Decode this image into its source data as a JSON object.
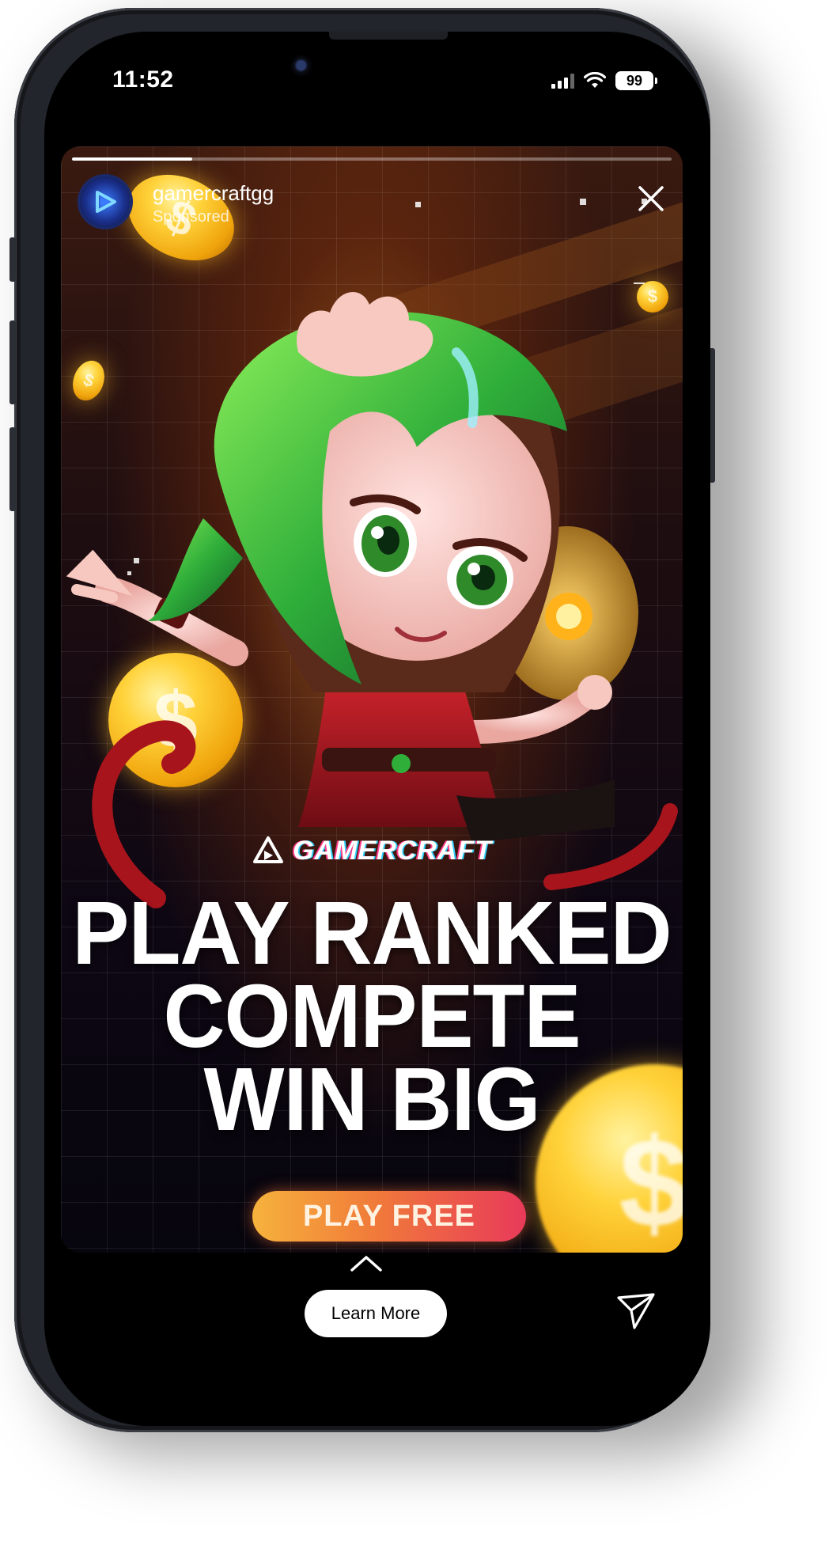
{
  "status_bar": {
    "time": "11:52",
    "battery": "99",
    "signal_icon": "cellular-signal-icon",
    "wifi_icon": "wifi-icon"
  },
  "story": {
    "progress_fraction": 0.2,
    "account_name": "gamercraftgg",
    "sponsored_label": "Sponsored",
    "close_icon": "close-icon",
    "brand_name": "GAMERCRAFT",
    "headline_lines": [
      "PLAY RANKED",
      "COMPETE",
      "WIN BIG"
    ],
    "cta_label": "PLAY FREE"
  },
  "footer": {
    "swipe_icon": "chevron-up-icon",
    "learn_more_label": "Learn More",
    "share_icon": "send-icon"
  },
  "colors": {
    "cta_start": "#f6b23c",
    "cta_end": "#e83a5a",
    "coin": "#ffd23a",
    "hair": "#2fae3a"
  }
}
